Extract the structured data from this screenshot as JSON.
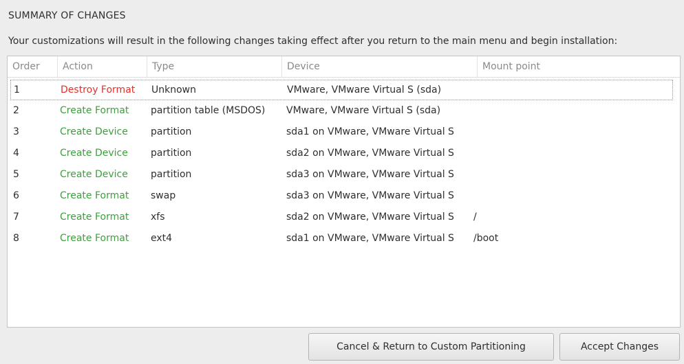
{
  "dialog": {
    "title": "SUMMARY OF CHANGES",
    "subtitle": "Your customizations will result in the following changes taking effect after you return to the main menu and begin installation:"
  },
  "table": {
    "headers": [
      "Order",
      "Action",
      "Type",
      "Device",
      "Mount point"
    ],
    "rows": [
      {
        "order": "1",
        "action": "Destroy Format",
        "action_kind": "destroy",
        "type": "Unknown",
        "device": "VMware, VMware Virtual S (sda)",
        "mount": ""
      },
      {
        "order": "2",
        "action": "Create Format",
        "action_kind": "create",
        "type": "partition table (MSDOS)",
        "device": "VMware, VMware Virtual S (sda)",
        "mount": ""
      },
      {
        "order": "3",
        "action": "Create Device",
        "action_kind": "create",
        "type": "partition",
        "device": "sda1 on VMware, VMware Virtual S",
        "mount": ""
      },
      {
        "order": "4",
        "action": "Create Device",
        "action_kind": "create",
        "type": "partition",
        "device": "sda2 on VMware, VMware Virtual S",
        "mount": ""
      },
      {
        "order": "5",
        "action": "Create Device",
        "action_kind": "create",
        "type": "partition",
        "device": "sda3 on VMware, VMware Virtual S",
        "mount": ""
      },
      {
        "order": "6",
        "action": "Create Format",
        "action_kind": "create",
        "type": "swap",
        "device": "sda3 on VMware, VMware Virtual S",
        "mount": ""
      },
      {
        "order": "7",
        "action": "Create Format",
        "action_kind": "create",
        "type": "xfs",
        "device": "sda2 on VMware, VMware Virtual S",
        "mount": "/"
      },
      {
        "order": "8",
        "action": "Create Format",
        "action_kind": "create",
        "type": "ext4",
        "device": "sda1 on VMware, VMware Virtual S",
        "mount": "/boot"
      }
    ]
  },
  "buttons": {
    "cancel_label": "Cancel & Return to Custom Partitioning",
    "accept_label": "Accept Changes"
  },
  "colors": {
    "destroy": "#e0312a",
    "create": "#3d9e3d"
  }
}
